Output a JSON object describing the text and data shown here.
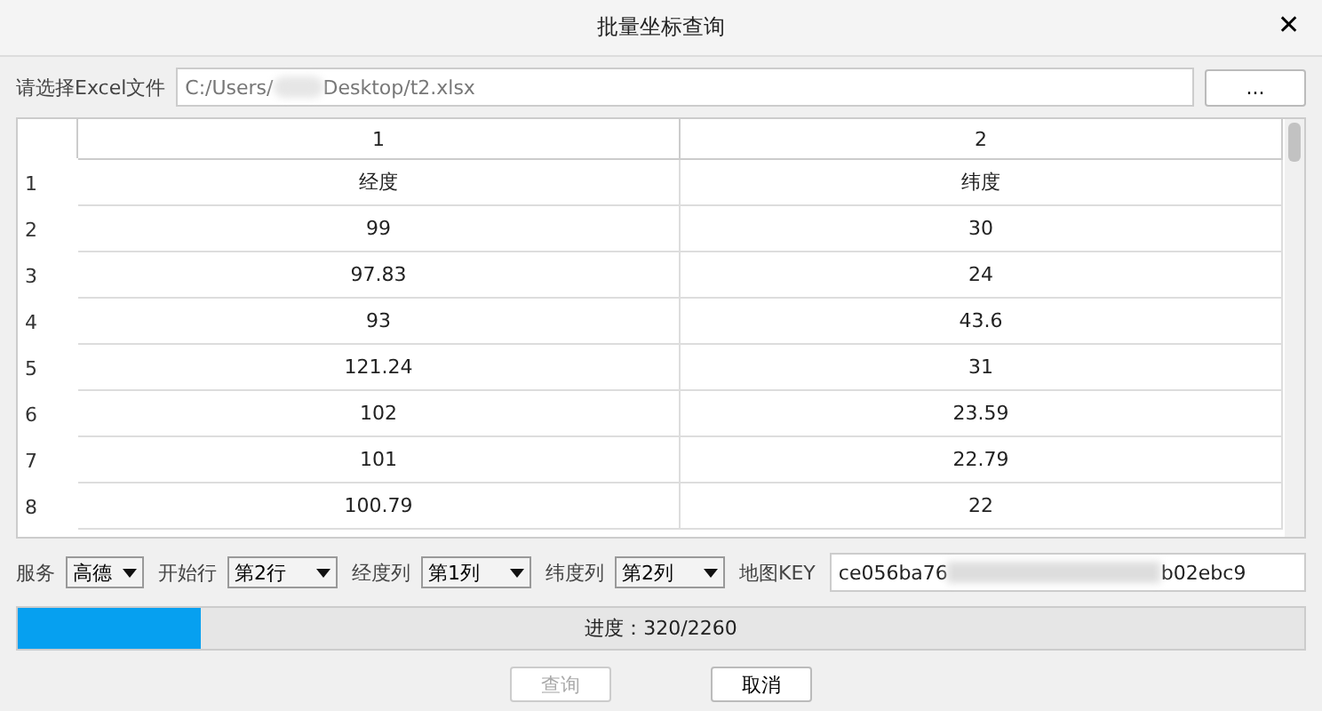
{
  "window": {
    "title": "批量坐标查询",
    "close": "✕"
  },
  "file": {
    "label": "请选择Excel文件",
    "value_parts": [
      "C:/Users/",
      "Desktop/t2.xlsx"
    ],
    "browse": "..."
  },
  "table": {
    "columns": [
      "1",
      "2"
    ],
    "rows": [
      {
        "header": "1",
        "cells": [
          "经度",
          "纬度"
        ]
      },
      {
        "header": "2",
        "cells": [
          "99",
          "30"
        ]
      },
      {
        "header": "3",
        "cells": [
          "97.83",
          "24"
        ]
      },
      {
        "header": "4",
        "cells": [
          "93",
          "43.6"
        ]
      },
      {
        "header": "5",
        "cells": [
          "121.24",
          "31"
        ]
      },
      {
        "header": "6",
        "cells": [
          "102",
          "23.59"
        ]
      },
      {
        "header": "7",
        "cells": [
          "101",
          "22.79"
        ]
      },
      {
        "header": "8",
        "cells": [
          "100.79",
          "22"
        ]
      }
    ]
  },
  "options": [
    {
      "label": "服务",
      "value": "高德"
    },
    {
      "label": "开始行",
      "value": "第2行"
    },
    {
      "label": "经度列",
      "value": "第1列"
    },
    {
      "label": "纬度列",
      "value": "第2列"
    }
  ],
  "key": {
    "label": "地图KEY",
    "value_parts": [
      "ce056ba76",
      "b02ebc9"
    ]
  },
  "progress": {
    "level": 0.142,
    "text": "进度：320/2260"
  },
  "buttons": [
    {
      "label": "查询",
      "disabled": true
    },
    {
      "label": "取消",
      "disabled": false
    }
  ]
}
